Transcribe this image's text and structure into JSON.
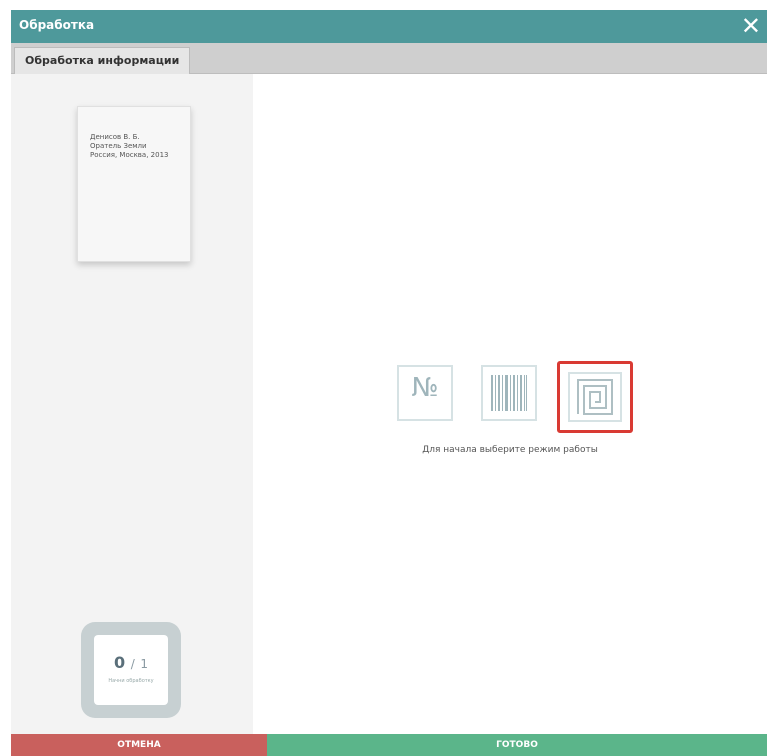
{
  "window": {
    "title": "Обработка",
    "close_symbol": "✕",
    "accent_color": "#4e999b"
  },
  "tabs": [
    {
      "label": "Обработка информации",
      "active": true
    }
  ],
  "document": {
    "lines": [
      "Денисов В. Б.",
      "Оратель Земли",
      "Россия, Москва, 2013"
    ]
  },
  "counter": {
    "current": "0",
    "separator": "/",
    "total": "1",
    "label": "Начни обработку"
  },
  "modes": [
    {
      "id": "number",
      "symbol": "№",
      "icon": "number-sign-icon",
      "selected": false
    },
    {
      "id": "barcode",
      "icon": "barcode-icon",
      "selected": false
    },
    {
      "id": "rfid",
      "icon": "rfid-tag-icon",
      "selected": true,
      "highlight_color": "#d93a33"
    }
  ],
  "hint": "Для начала выберите режим работы",
  "footer": {
    "cancel_label": "ОТМЕНА",
    "cancel_color": "#c9605d",
    "done_label": "ГОТОВО",
    "done_color": "#5bb58a"
  }
}
